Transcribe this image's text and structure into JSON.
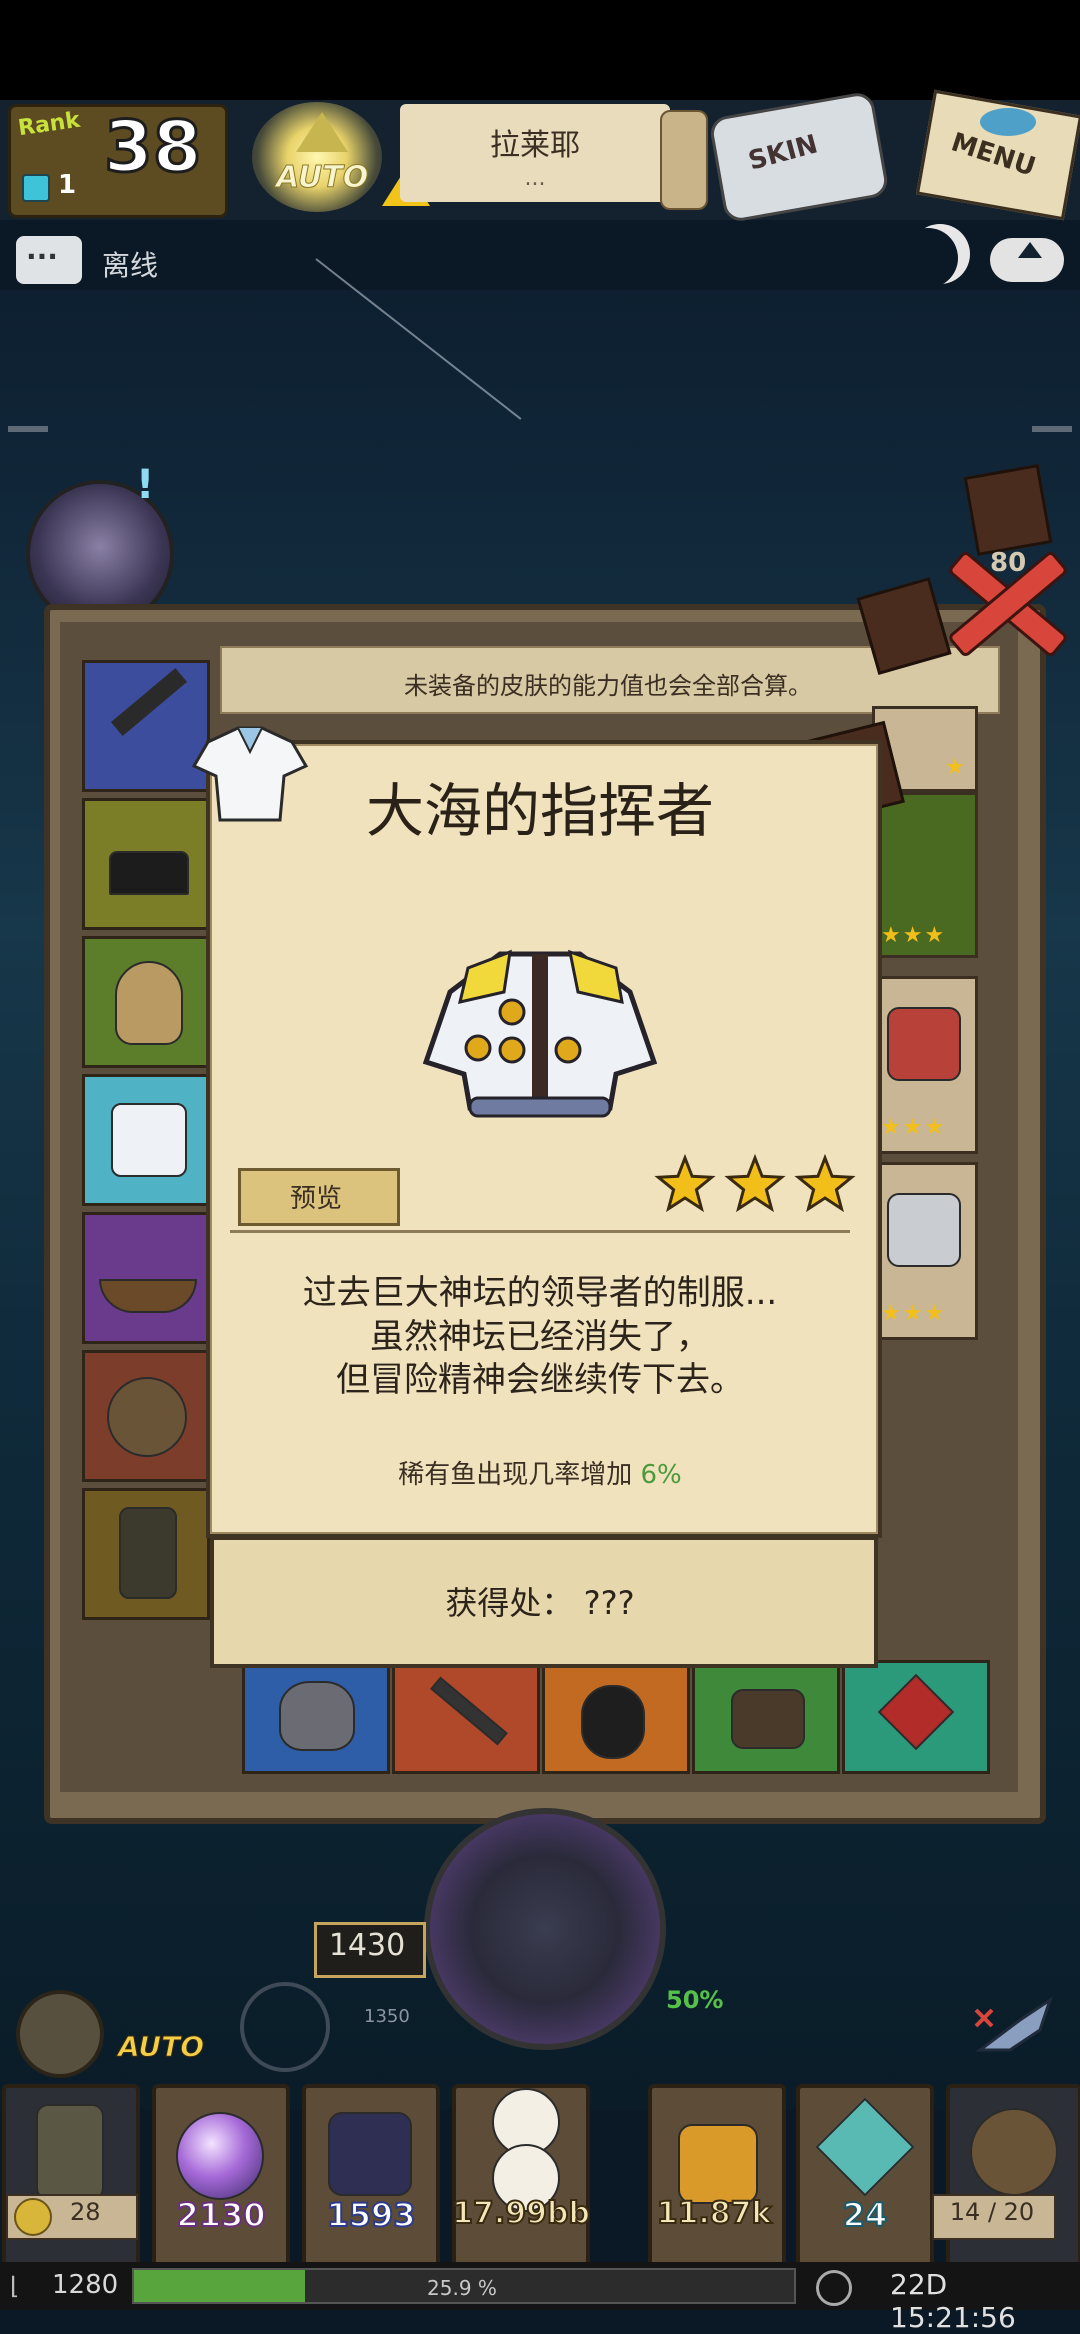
{
  "hud": {
    "rank_label": "Rank",
    "rank_value": "38",
    "gems": "1",
    "auto_label": "AUTO",
    "location_name": "拉莱耶",
    "location_sub": "...",
    "skin_label": "SKIN",
    "menu_label": "MENU"
  },
  "chat": {
    "status": "离线"
  },
  "panel": {
    "notice": "未装备的皮肤的能力值也会全部合算。",
    "side_counter": "80"
  },
  "popup": {
    "title": "大海的指挥者",
    "preview_label": "预览",
    "stars": 3,
    "description_lines": [
      "过去巨大神坛的领导者的制服...",
      "虽然神坛已经消失了，",
      "但冒险精神会继续传下去。"
    ],
    "stat_label": "稀有鱼出现几率增加",
    "stat_value": "6%",
    "source_label": "获得处：",
    "source_value": "???"
  },
  "bottom": {
    "depth": "1430",
    "depth_sub": "1350",
    "boost_pct": "50%",
    "auto_label": "AUTO",
    "lamp_count": "28",
    "resources": [
      "2130",
      "1593",
      "17.99bb",
      "11.87k",
      "24"
    ],
    "capacity": "14 / 20"
  },
  "status": {
    "level": "1280",
    "xp_percent": "25.9 %",
    "xp_fill_fraction": 0.259,
    "timer": "22D 15:21:56"
  },
  "colors": {
    "accent_green": "#4b9a3a",
    "star_gold": "#f2bf1a",
    "close_red": "#d8453a"
  }
}
